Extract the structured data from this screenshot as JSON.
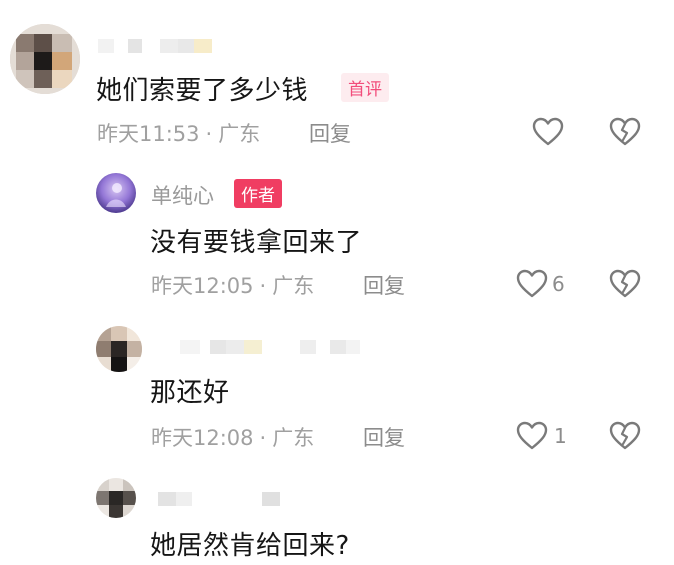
{
  "comments": [
    {
      "text": "她们索要了多少钱",
      "badge": "首评",
      "time": "昨天11:53",
      "location": "广东",
      "reply_label": "回复"
    },
    {
      "username": "单纯心",
      "badge": "作者",
      "text": "没有要钱拿回来了",
      "time": "昨天12:05",
      "location": "广东",
      "reply_label": "回复",
      "likes": "6"
    },
    {
      "text": "那还好",
      "time": "昨天12:08",
      "location": "广东",
      "reply_label": "回复",
      "likes": "1"
    },
    {
      "text": "她居然肯给回来?"
    }
  ],
  "separator": "·",
  "colors": {
    "author_badge": "#f03d62",
    "first_badge_text": "#f24d7b",
    "meta_text": "#a0a0a0"
  },
  "icons": [
    "heart-outline-icon",
    "broken-heart-icon"
  ]
}
